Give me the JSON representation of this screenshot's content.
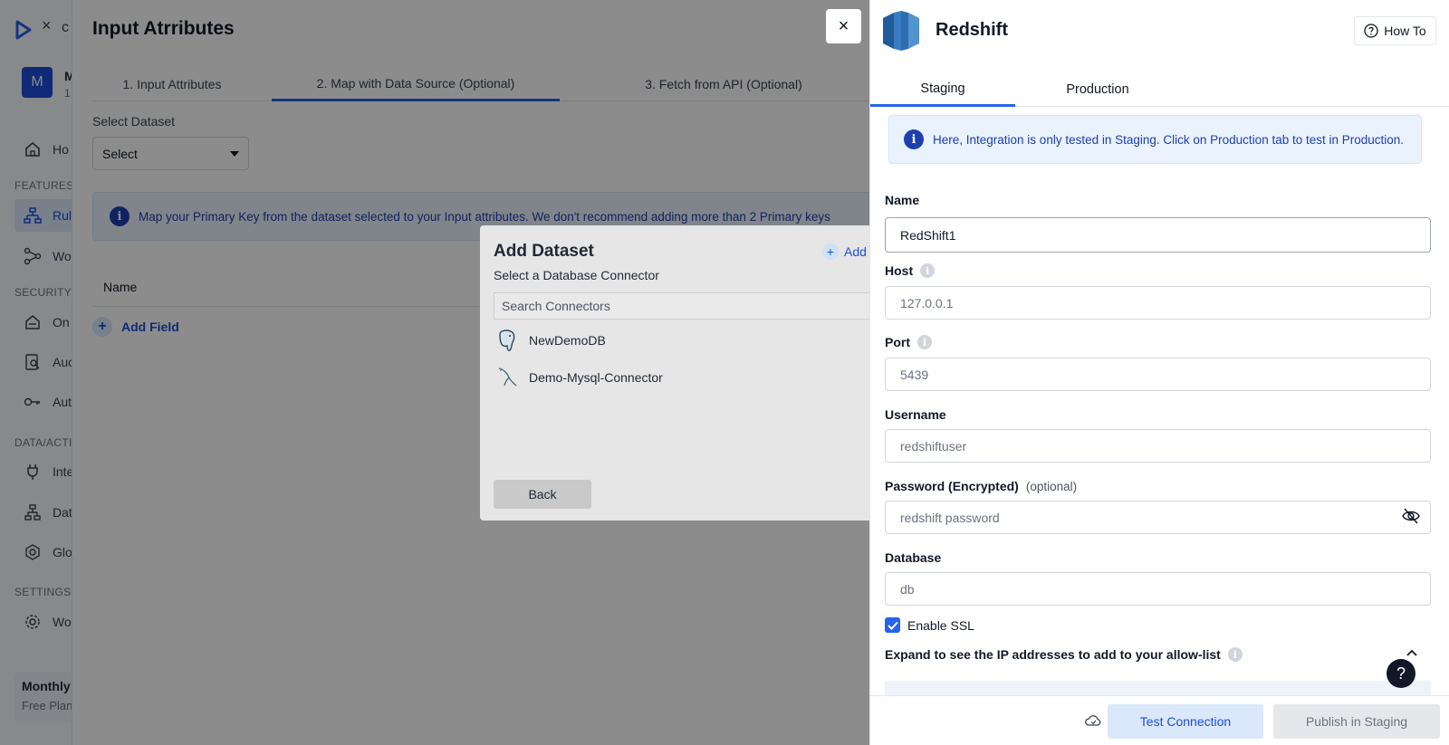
{
  "sidebar": {
    "org_initial": "M",
    "org_name": "M",
    "org_sub": "1",
    "sections": {
      "features": "FEATURES",
      "security": "SECURITY",
      "data": "DATA/ACTIC",
      "settings": "SETTINGS"
    },
    "items": [
      {
        "label": "Ho",
        "icon": "home-icon"
      },
      {
        "label": "Rul",
        "icon": "rules-icon"
      },
      {
        "label": "Wo",
        "icon": "workflow-icon"
      },
      {
        "label": "On",
        "icon": "onboarding-icon"
      },
      {
        "label": "Auc",
        "icon": "audit-icon"
      },
      {
        "label": "Aut",
        "icon": "key-icon"
      },
      {
        "label": "Inte",
        "icon": "plug-icon"
      },
      {
        "label": "Dat",
        "icon": "data-icon"
      },
      {
        "label": "Glo",
        "icon": "globe-gear-icon"
      },
      {
        "label": "Wo",
        "icon": "gear-icon"
      }
    ],
    "plan": {
      "title": "Monthly",
      "subtitle": "Free Plan"
    }
  },
  "main": {
    "title": "Input Atrributes",
    "steps": [
      "1. Input Attributes",
      "2. Map with Data Source (Optional)",
      "3. Fetch from API (Optional)"
    ],
    "active_step": 1,
    "select_dataset_label": "Select Dataset",
    "select_value": "Select",
    "info_text": "Map your Primary Key from the dataset selected to your Input attributes. We don't recommend adding more than 2 Primary keys",
    "name_header": "Name",
    "add_field": "Add Field"
  },
  "modal": {
    "title": "Add Dataset",
    "add_label": "Add D",
    "subtitle": "Select a Database Connector",
    "search_placeholder": "Search Connectors",
    "connectors": [
      {
        "name": "NewDemoDB",
        "icon": "postgres-elephant-icon"
      },
      {
        "name": "Demo-Mysql-Connector",
        "icon": "mysql-dolphin-icon"
      }
    ],
    "back_label": "Back"
  },
  "drawer": {
    "title": "Redshift",
    "how_to": "How To",
    "tabs": [
      "Staging",
      "Production"
    ],
    "active_tab": 0,
    "info_text": "Here, Integration is only tested in Staging. Click on Production tab to test in Production.",
    "fields": {
      "name": {
        "label": "Name",
        "value": "RedShift1"
      },
      "host": {
        "label": "Host",
        "placeholder": "127.0.0.1"
      },
      "port": {
        "label": "Port",
        "placeholder": "5439"
      },
      "username": {
        "label": "Username",
        "placeholder": "redshiftuser"
      },
      "password": {
        "label": "Password (Encrypted)",
        "optional": "(optional)",
        "placeholder": "redshift password"
      },
      "database": {
        "label": "Database",
        "placeholder": "db"
      }
    },
    "enable_ssl": {
      "label": "Enable SSL",
      "checked": true
    },
    "expand_text": "Expand to see the IP addresses to add to your allow-list",
    "footer": {
      "test_label": "Test Connection",
      "publish_label": "Publish in Staging"
    }
  },
  "colors": {
    "accent": "#2563eb",
    "info_bg": "#eaf2fd",
    "info_text": "#1e40af",
    "overlay": "rgba(0,0,0,0.45)"
  }
}
